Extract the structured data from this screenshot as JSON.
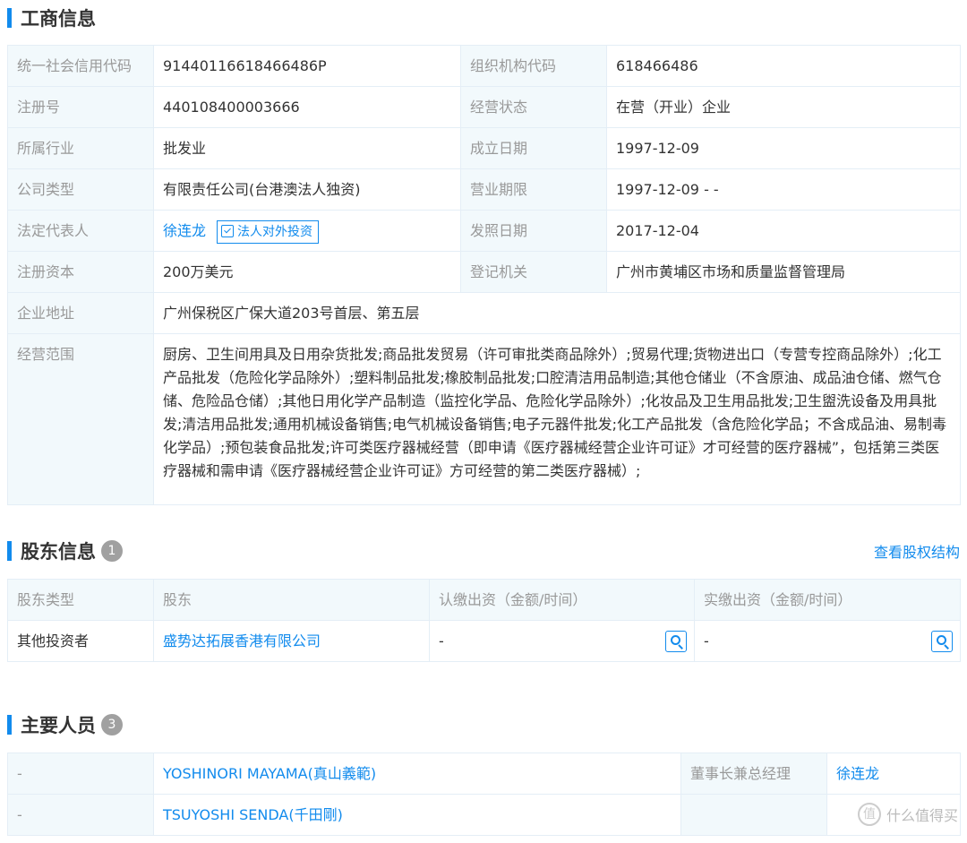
{
  "business": {
    "title": "工商信息",
    "rows": [
      [
        {
          "l": "统一社会信用代码",
          "v": "91440116618466486P"
        },
        {
          "l": "组织机构代码",
          "v": "618466486"
        }
      ],
      [
        {
          "l": "注册号",
          "v": "440108400003666"
        },
        {
          "l": "经营状态",
          "v": "在营（开业）企业"
        }
      ],
      [
        {
          "l": "所属行业",
          "v": "批发业"
        },
        {
          "l": "成立日期",
          "v": "1997-12-09"
        }
      ],
      [
        {
          "l": "公司类型",
          "v": "有限责任公司(台港澳法人独资)"
        },
        {
          "l": "营业期限",
          "v": "1997-12-09 - -"
        }
      ],
      [
        {
          "l": "法定代表人",
          "v": "徐连龙"
        },
        {
          "l": "发照日期",
          "v": "2017-12-04"
        }
      ],
      [
        {
          "l": "注册资本",
          "v": "200万美元"
        },
        {
          "l": "登记机关",
          "v": "广州市黄埔区市场和质量监督管理局"
        }
      ]
    ],
    "legal_rep_button": "法人对外投资",
    "address_label": "企业地址",
    "address": "广州保税区广保大道203号首层、第五层",
    "scope_label": "经营范围",
    "scope": "厨房、卫生间用具及日用杂货批发;商品批发贸易（许可审批类商品除外）;贸易代理;货物进出口（专营专控商品除外）;化工产品批发（危险化学品除外）;塑料制品批发;橡胶制品批发;口腔清洁用品制造;其他仓储业（不含原油、成品油仓储、燃气仓储、危险品仓储）;其他日用化学产品制造（监控化学品、危险化学品除外）;化妆品及卫生用品批发;卫生盥洗设备及用具批发;清洁用品批发;通用机械设备销售;电气机械设备销售;电子元器件批发;化工产品批发（含危险化学品；不含成品油、易制毒化学品）;预包装食品批发;许可类医疗器械经营（即申请《医疗器械经营企业许可证》才可经营的医疗器械”，包括第三类医疗器械和需申请《医疗器械经营企业许可证》方可经营的第二类医疗器械）;"
  },
  "shareholders": {
    "title": "股东信息",
    "count": "1",
    "link": "查看股权结构",
    "headers": [
      "股东类型",
      "股东",
      "认缴出资（金额/时间）",
      "实缴出资（金额/时间）"
    ],
    "rows": [
      {
        "type": "其他投资者",
        "name": "盛势达拓展香港有限公司",
        "subscribed": "-",
        "paid": "-"
      }
    ]
  },
  "staff": {
    "title": "主要人员",
    "count": "3",
    "rows": [
      {
        "idx": "-",
        "name": "YOSHINORI MAYAMA(真山義範)",
        "role": "董事长兼总经理",
        "person": "徐连龙"
      },
      {
        "idx": "-",
        "name": "TSUYOSHI SENDA(千田剛)",
        "role": "",
        "person": ""
      }
    ]
  },
  "watermark": "什么值得买",
  "accent_color": "#128bed"
}
